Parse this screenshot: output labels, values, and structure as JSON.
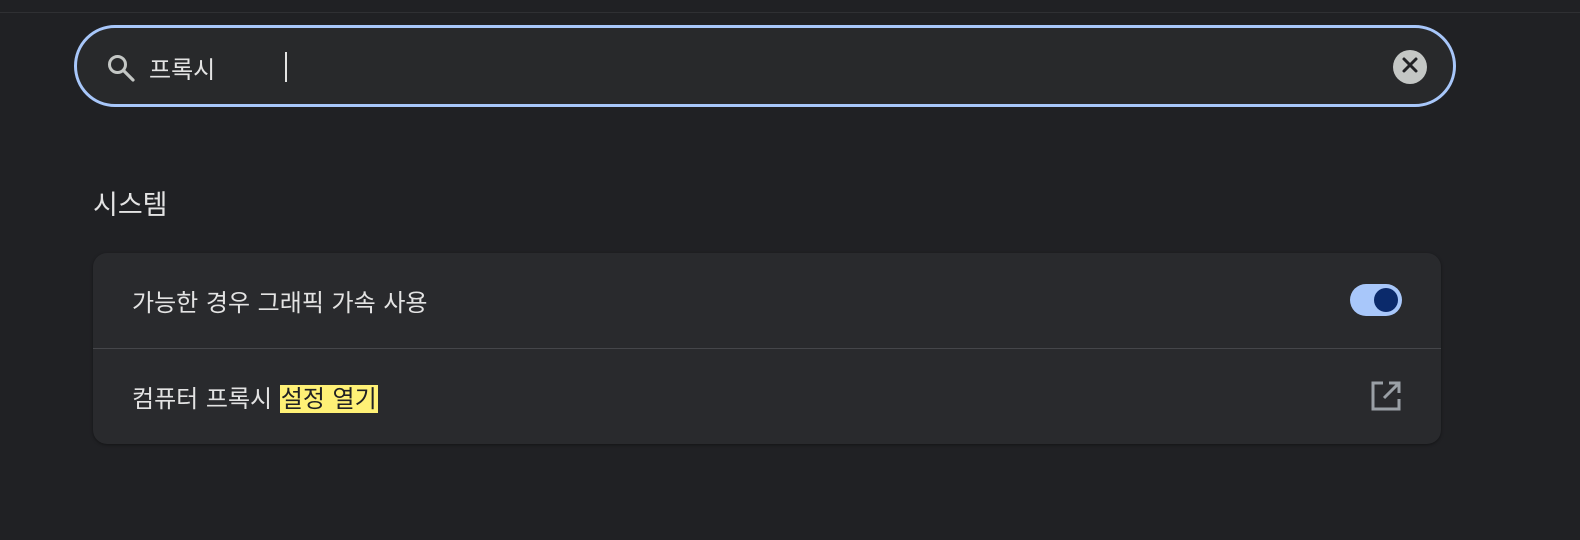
{
  "search": {
    "value": "프록시"
  },
  "section": {
    "title": "시스템"
  },
  "settings": [
    {
      "label": "가능한 경우 그래픽 가속 사용",
      "type": "toggle",
      "enabled": true
    },
    {
      "label_prefix": "컴퓨터 프록시 ",
      "label_highlight": "설정 열기",
      "type": "external-link"
    }
  ],
  "colors": {
    "background": "#202124",
    "accent": "#a8c7fa",
    "highlight": "#fff176"
  },
  "icons": {
    "search": "search-icon",
    "clear": "close-icon",
    "external": "open-in-new-icon"
  }
}
